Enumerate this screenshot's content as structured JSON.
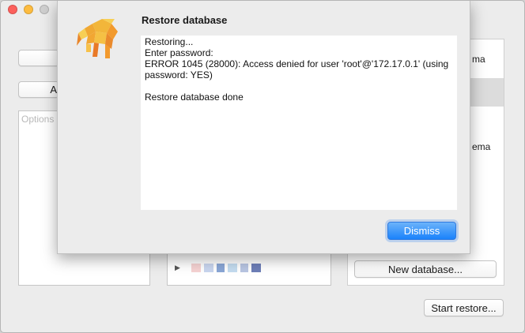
{
  "window": {
    "traffic_lights": [
      "close",
      "minimize",
      "zoom"
    ]
  },
  "left": {
    "button1_label": "",
    "button2_label": "A",
    "options_placeholder": "Options"
  },
  "right": {
    "item1_partial": "ma",
    "item2_partial": "ema",
    "new_database_label": "New database..."
  },
  "footer": {
    "start_restore_label": "Start restore..."
  },
  "tree": {
    "disclosure": "▶",
    "blurred_colors": [
      "#f6d3d3",
      "#c9d6ef",
      "#8aa7d6",
      "#c4dcf0",
      "#b9c6e3",
      "#6e7fb8"
    ]
  },
  "sheet": {
    "title": "Restore database",
    "log_lines": [
      "Restoring...",
      "Enter password:",
      "ERROR 1045 (28000): Access denied for user 'root'@'172.17.0.1' (using",
      "password: YES)",
      "",
      "Restore database done"
    ],
    "dismiss_label": "Dismiss",
    "accent_color": "#1a82fb"
  }
}
